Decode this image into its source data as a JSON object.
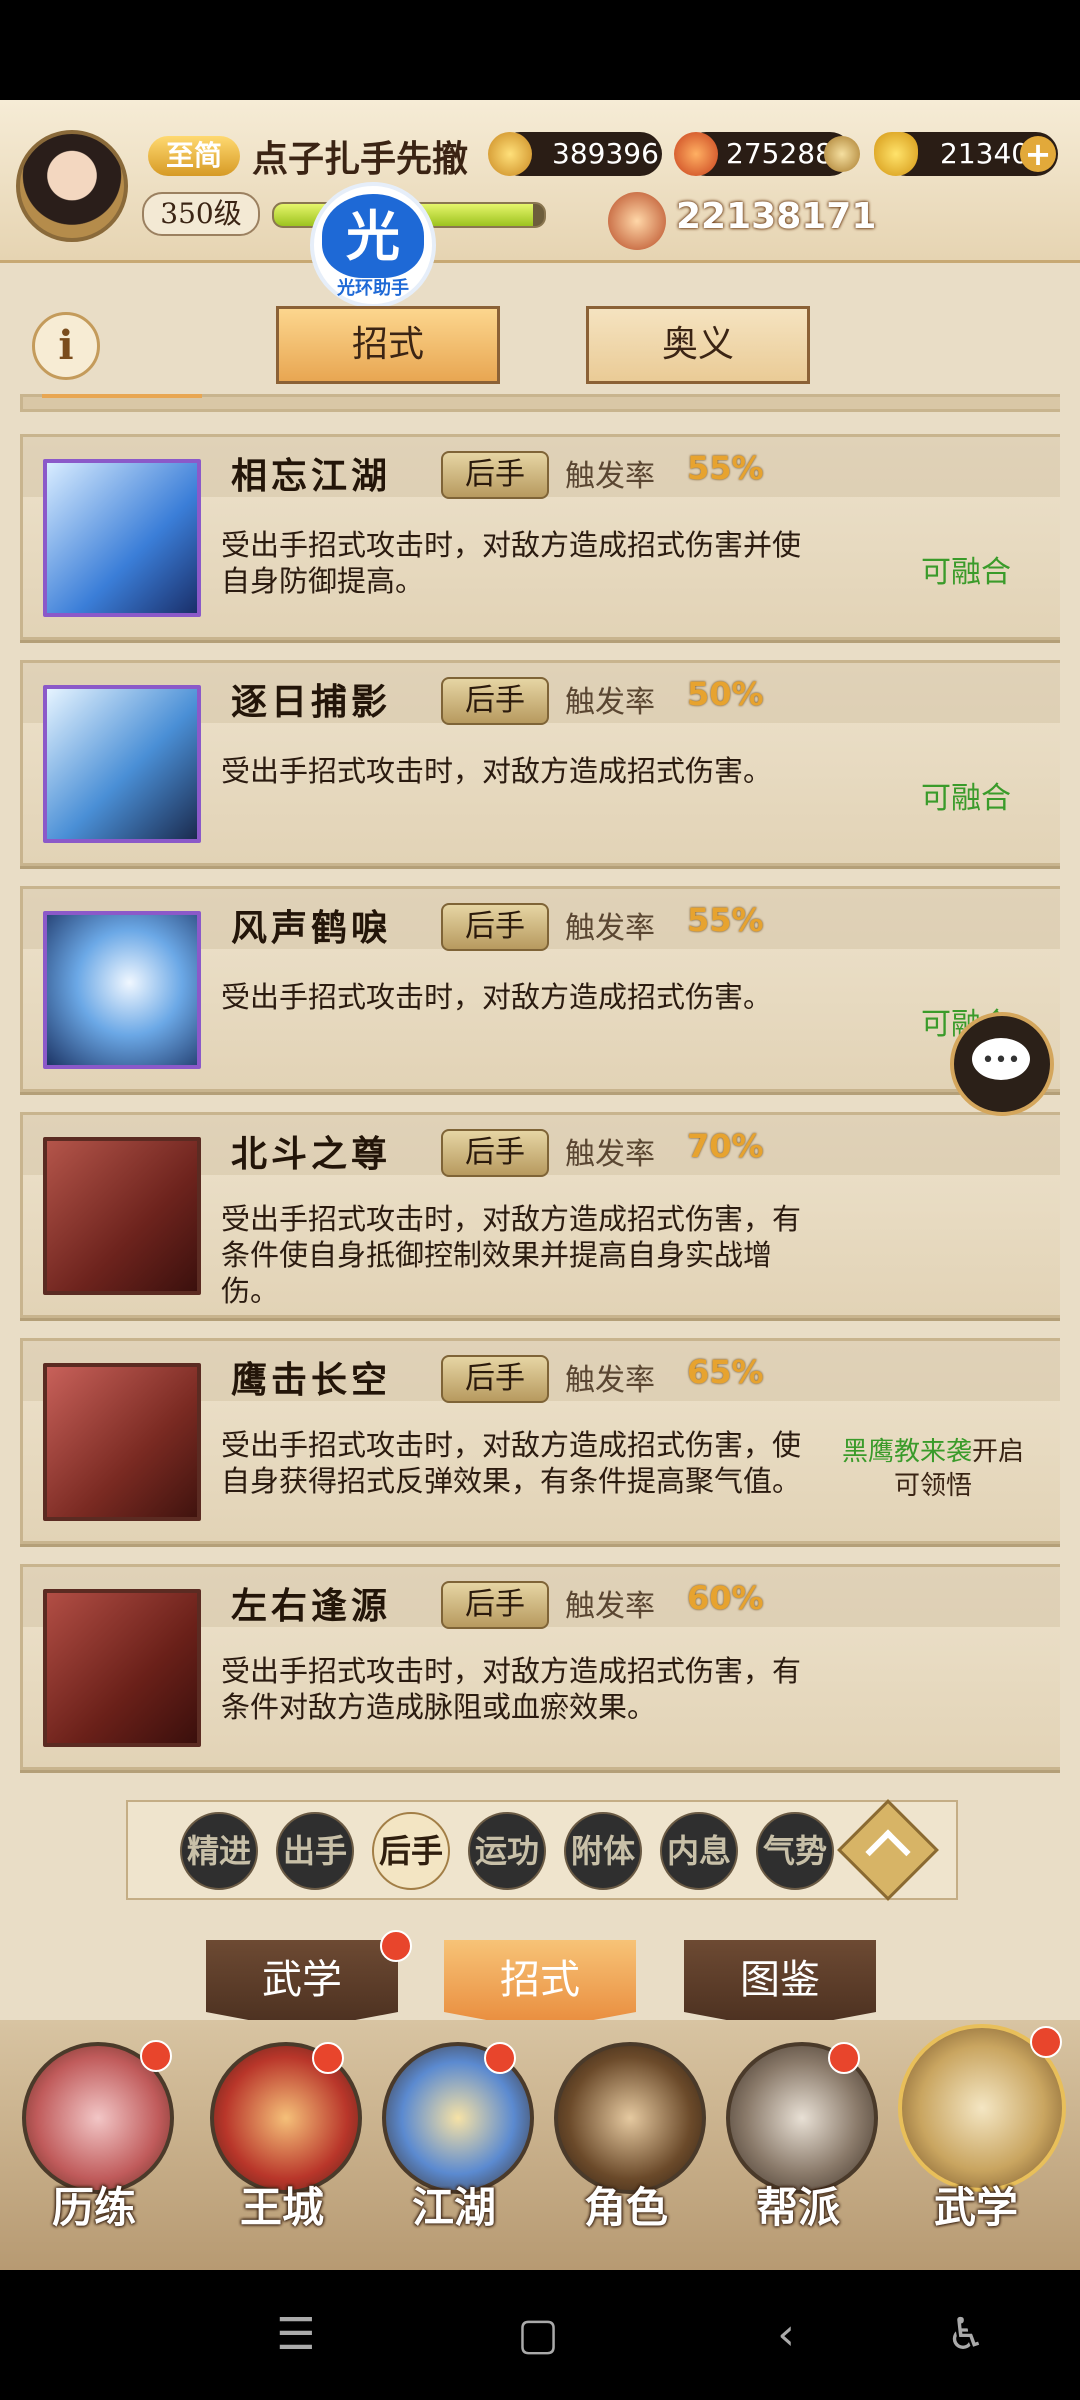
{
  "player": {
    "vip": "至简",
    "name": "点子扎手先撤",
    "level": "350级",
    "exp_fraction": 0.96,
    "copper": "389396",
    "fire_currency": "275288",
    "gold": "21340",
    "combat_power": "22138171"
  },
  "helper": {
    "badge_char": "光",
    "label": "光环助手"
  },
  "subtabs": [
    {
      "label": "招式",
      "active": true
    },
    {
      "label": "奥义",
      "active": false
    }
  ],
  "info_label": "i",
  "rate_label": "触发率",
  "skills": [
    {
      "name": "相忘江湖",
      "tag": "后手",
      "rate": "55%",
      "desc": "受出手招式攻击时，对敌方造成招式伤害并使自身防御提高。",
      "status": "可融合"
    },
    {
      "name": "逐日捕影",
      "tag": "后手",
      "rate": "50%",
      "desc": "受出手招式攻击时，对敌方造成招式伤害。",
      "status": "可融合"
    },
    {
      "name": "风声鹤唳",
      "tag": "后手",
      "rate": "55%",
      "desc": "受出手招式攻击时，对敌方造成招式伤害。",
      "status": "可融合"
    },
    {
      "name": "北斗之尊",
      "tag": "后手",
      "rate": "70%",
      "desc": "受出手招式攻击时，对敌方造成招式伤害，有条件使自身抵御控制效果并提高自身实战增伤。",
      "status": ""
    },
    {
      "name": "鹰击长空",
      "tag": "后手",
      "rate": "65%",
      "desc": "受出手招式攻击时，对敌方造成招式伤害，使自身获得招式反弹效果，有条件提高聚气值。",
      "status_event": "黑鹰教来袭",
      "status_suffix": "开启",
      "status_line2": "可领悟"
    },
    {
      "name": "左右逢源",
      "tag": "后手",
      "rate": "60%",
      "desc": "受出手招式攻击时，对敌方造成招式伤害，有条件对敌方造成脉阻或血瘀效果。",
      "status": ""
    }
  ],
  "filters": [
    {
      "label": "精进",
      "active": false
    },
    {
      "label": "出手",
      "active": false
    },
    {
      "label": "后手",
      "active": true
    },
    {
      "label": "运功",
      "active": false
    },
    {
      "label": "附体",
      "active": false
    },
    {
      "label": "内息",
      "active": false
    },
    {
      "label": "气势",
      "active": false
    }
  ],
  "bottom_tabs": [
    {
      "label": "武学",
      "active": false,
      "dot": true
    },
    {
      "label": "招式",
      "active": true,
      "dot": false
    },
    {
      "label": "图鉴",
      "active": false,
      "dot": false
    }
  ],
  "nav": [
    {
      "label": "历练",
      "icon": "training-icon",
      "dot": true
    },
    {
      "label": "王城",
      "icon": "city-icon",
      "dot": true
    },
    {
      "label": "江湖",
      "icon": "jianghu-icon",
      "dot": true
    },
    {
      "label": "角色",
      "icon": "character-icon",
      "dot": false
    },
    {
      "label": "帮派",
      "icon": "guild-icon",
      "dot": true
    },
    {
      "label": "武学",
      "icon": "martial-arts-icon",
      "dot": true
    }
  ],
  "colors": {
    "accent_orange": "#e8a652",
    "fuse_green": "#3a9b2a",
    "rate_gold": "#e7a32f"
  }
}
